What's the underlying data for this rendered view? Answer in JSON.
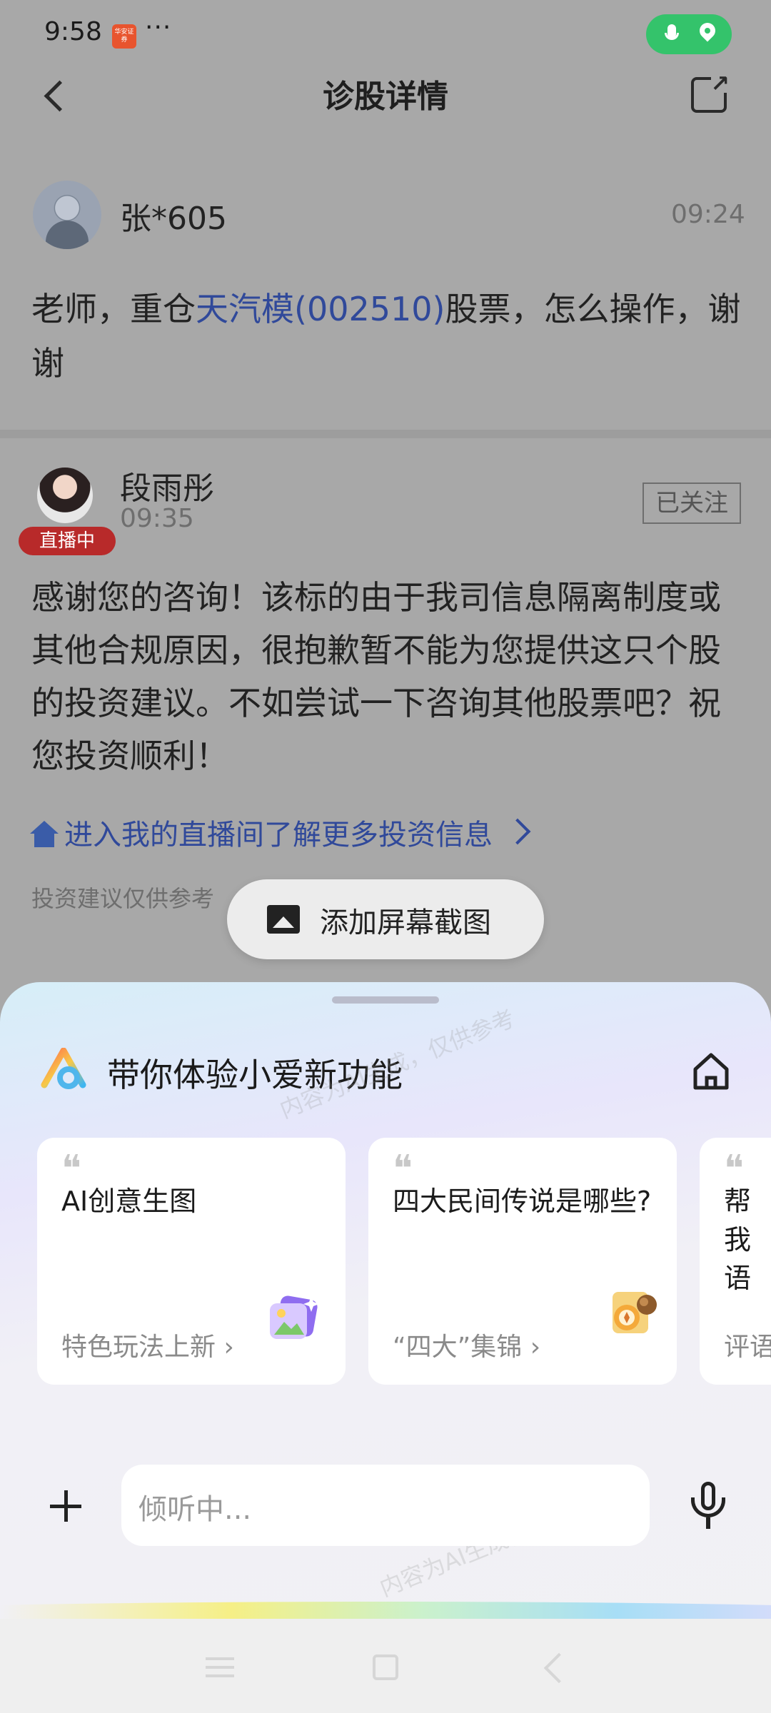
{
  "status_bar": {
    "time": "9:58",
    "app_icon_text": "华安证券",
    "more": "···"
  },
  "header": {
    "title": "诊股详情"
  },
  "question": {
    "user_name": "张*605",
    "time": "09:24",
    "text_before": "老师，重仓",
    "stock_link": "天汽模(002510)",
    "text_after": "股票，怎么操作，谢谢"
  },
  "answer": {
    "advisor_name": "段雨彤",
    "time": "09:35",
    "live_badge": "直播中",
    "follow_label": "已关注",
    "text": "感谢您的咨询！该标的由于我司信息隔离制度或其他合规原因，很抱歉暂不能为您提供这只个股的投资建议。不如尝试一下咨询其他股票吧？祝您投资顺利！",
    "live_link": "进入我的直播间了解更多投资信息",
    "disclaimer": "投资建议仅供参考"
  },
  "screenshot_button": {
    "label": "添加屏幕截图"
  },
  "assistant_sheet": {
    "title": "带你体验小爱新功能",
    "cards": [
      {
        "title": "AI创意生图",
        "subtitle": "特色玩法上新",
        "icon": "image-sparkle-icon"
      },
      {
        "title": "四大民间传说是哪些?",
        "subtitle": "“四大”集锦",
        "icon": "scroll-compass-icon"
      },
      {
        "title": "帮我语",
        "subtitle": "评语"
      }
    ],
    "input_placeholder": "倾听中...",
    "watermark": "内容为AI生成，仅供参考"
  }
}
